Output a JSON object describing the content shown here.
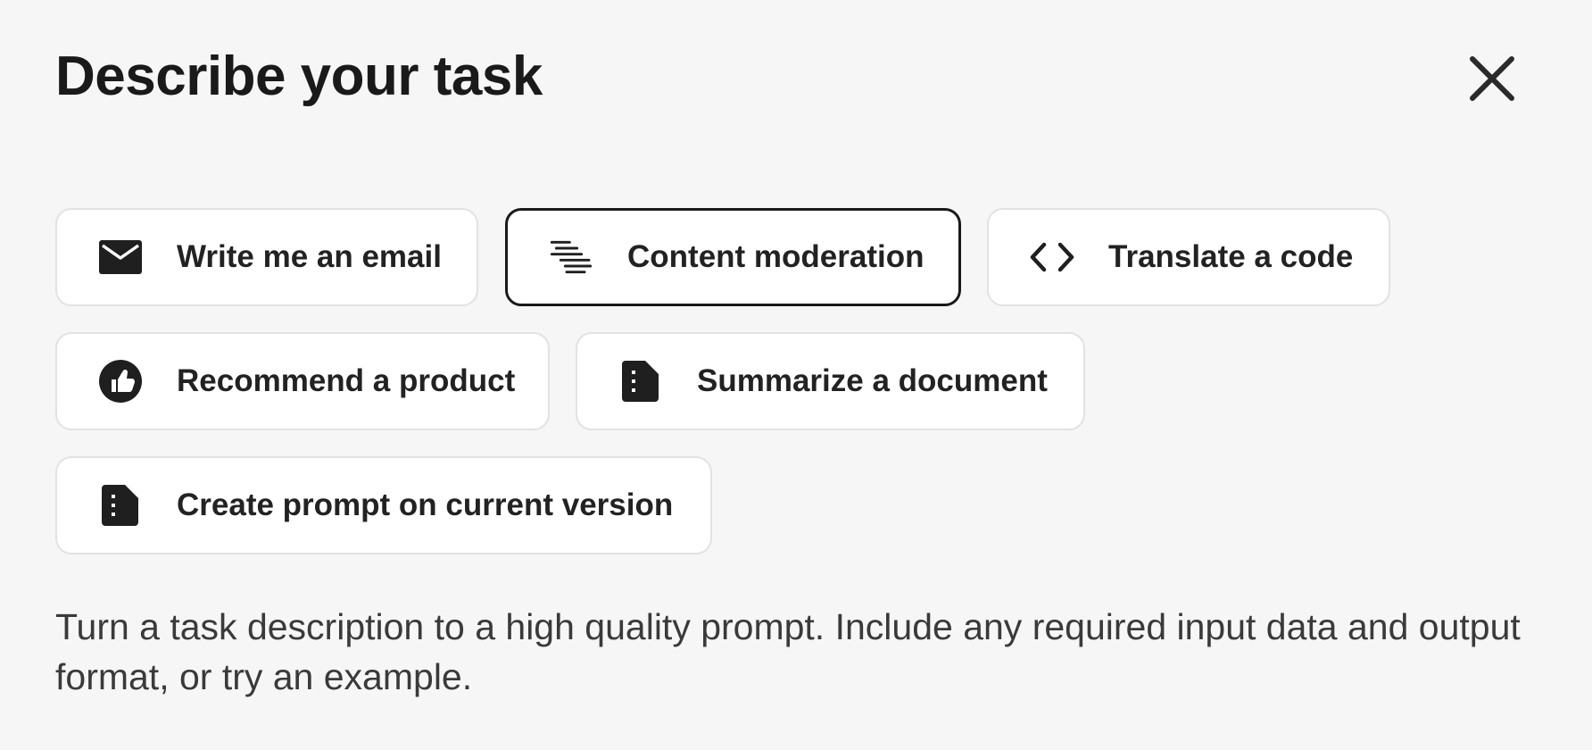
{
  "dialog": {
    "title": "Describe your task",
    "close_icon": "close-icon"
  },
  "task_buttons": [
    {
      "label": "Write me an email",
      "icon": "mail-icon",
      "selected": false
    },
    {
      "label": "Content moderation",
      "icon": "moderation-icon",
      "selected": true
    },
    {
      "label": "Translate a code",
      "icon": "code-icon",
      "selected": false
    },
    {
      "label": "Recommend a product",
      "icon": "thumbs-up-icon",
      "selected": false
    },
    {
      "label": "Summarize a document",
      "icon": "document-icon",
      "selected": false
    },
    {
      "label": "Create prompt on current version",
      "icon": "document-icon",
      "selected": false
    }
  ],
  "description": "Turn a task description to a high quality prompt. Include any required input data and output format, or try an example.",
  "colors": {
    "background": "#f6f6f6",
    "button_border": "#e2e2e2",
    "selected_border": "#1a1a1a",
    "text": "#222222"
  }
}
